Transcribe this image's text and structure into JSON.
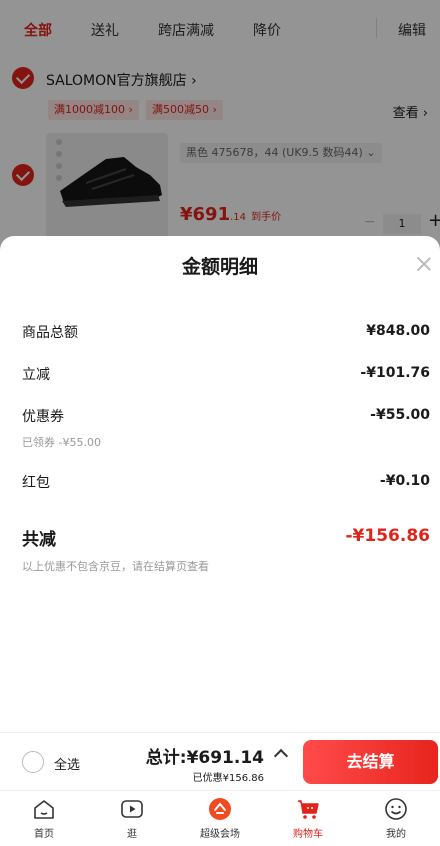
{
  "background": {
    "tabs": [
      "全部",
      "送礼",
      "跨店满减",
      "降价"
    ],
    "edit_label": "编辑",
    "store_name": "SALOMON官方旗舰店 ›",
    "promos": [
      "满1000减100 ›",
      "满500减50 ›"
    ],
    "view_label": "查看 ›",
    "spec": "黑色 475678，44 (UK9.5 数码44) ⌄",
    "price_main": "¥691",
    "price_decimal": ".14",
    "price_suffix": "到手价",
    "quantity": "1"
  },
  "sheet": {
    "title": "金额明细",
    "rows": [
      {
        "label": "商品总额",
        "value": "¥848.00"
      },
      {
        "label": "立减",
        "value": "-¥101.76"
      },
      {
        "label": "优惠券",
        "value": "-¥55.00",
        "note": "已领券 -¥55.00"
      },
      {
        "label": "红包",
        "value": "-¥0.10"
      }
    ],
    "total_label": "共减",
    "total_value": "-¥156.86",
    "footnote": "以上优惠不包含京豆，请在结算页查看"
  },
  "bottom_bar": {
    "select_all": "全选",
    "total": "总计:¥691.14",
    "saved": "已优惠¥156.86",
    "checkout": "去结算"
  },
  "nav": [
    {
      "label": "首页",
      "icon": "home-icon"
    },
    {
      "label": "逛",
      "icon": "video-play-icon"
    },
    {
      "label": "超级会场",
      "icon": "super-venue-icon"
    },
    {
      "label": "购物车",
      "icon": "cart-icon"
    },
    {
      "label": "我的",
      "icon": "smile-profile-icon"
    }
  ],
  "colors": {
    "accent": "#e2231a",
    "checkout_gradient_start": "#ff4b4b",
    "checkout_gradient_end": "#e8241d"
  }
}
